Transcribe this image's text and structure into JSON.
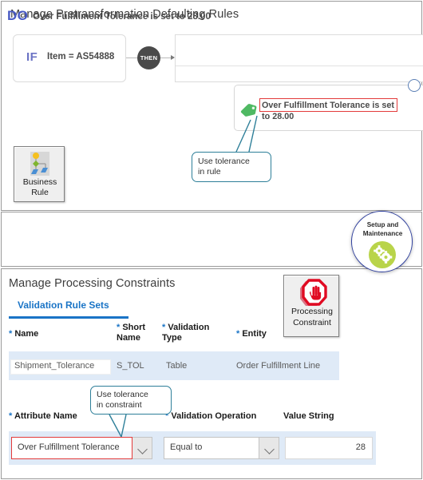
{
  "top_panel": {
    "title": "Manage Pretransformation Defaulting Rules",
    "if_keyword": "IF",
    "if_expression": "Item = AS54888",
    "then_label": "THEN",
    "do_keyword": "DO",
    "do_text": "Over Fulfillment Tolerance is set to 28.00",
    "action_text": "Over Fulfillment Tolerance is set to 28.00",
    "action_highlight_text": "Over Fulfillment Tolerance",
    "callout": "Use tolerance\nin rule",
    "callout_line1": "Use tolerance",
    "callout_line2": "in rule",
    "business_rule_icon": {
      "label_line1": "Business",
      "label_line2": "Rule",
      "icon_name": "business-rule-icon"
    }
  },
  "setup_badge": {
    "line1": "Setup and",
    "line2": "Maintenance",
    "icon_name": "gears-icon",
    "accent_color": "#b9d44a",
    "ring_color": "#2e3f9e"
  },
  "bottom_panel": {
    "title": "Manage Processing Constraints",
    "tab_label": "Validation Rule Sets",
    "processing_constraint_icon": {
      "label_line1": "Processing",
      "label_line2": "Constraint",
      "icon_name": "stop-hand-icon"
    },
    "grid": {
      "headers": [
        {
          "required": "*",
          "label": "Name"
        },
        {
          "required": "*",
          "label_line1": "Short",
          "label_line2": "Name"
        },
        {
          "required": "*",
          "label_line1": "Validation",
          "label_line2": "Type"
        },
        {
          "required": "*",
          "label": "Entity"
        }
      ],
      "row": {
        "name": "Shipment_Tolerance",
        "short_name": "S_TOL",
        "validation_type": "Table",
        "entity": "Order Fulfillment Line"
      }
    },
    "callout_line1": "Use tolerance",
    "callout_line2": "in constraint",
    "form": {
      "headers": {
        "attribute_name": "Attribute Name",
        "attribute_required": "*",
        "validation_operation": "Validation Operation",
        "validation_required": "*",
        "value_string": "Value String"
      },
      "attribute_name_value": "Over Fulfillment Tolerance",
      "validation_operation_value": "Equal to",
      "value_string_value": "28"
    }
  },
  "colors": {
    "highlight_red": "#e33b3b",
    "callout_teal": "#2e7f99",
    "link_blue": "#1a74c6",
    "row_blue": "#dfeaf7",
    "if_purple": "#6b73c4",
    "do_blue": "#4a5bc4"
  }
}
